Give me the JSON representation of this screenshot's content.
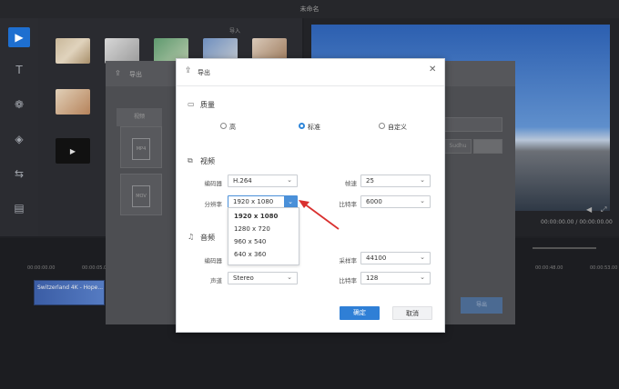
{
  "app": {
    "title": "未命名"
  },
  "editor": {
    "media_tab_label": "导入",
    "media_captions": [
      "",
      "",
      "",
      "",
      "",
      "",
      "",
      ""
    ],
    "time_display": "00:00:00.00 / 00:00:00.00",
    "ruler_labels": [
      "00:00:00.00",
      "00:00:05.00",
      "00:00:48.00",
      "00:00:53.00"
    ],
    "clip_label": "Switzerland 4K - Hope..."
  },
  "bg_dialog": {
    "title": "导出",
    "tab": "视频",
    "format1": "MP4",
    "format2": "MOV",
    "right_button": "导出",
    "mid_label": "Sudhu"
  },
  "dialog": {
    "title": "导出",
    "close_icon": "close-icon",
    "quality": {
      "title": "质量",
      "options": [
        {
          "label": "高",
          "checked": false
        },
        {
          "label": "标准",
          "checked": true
        },
        {
          "label": "自定义",
          "checked": false
        }
      ]
    },
    "video": {
      "title": "视频",
      "encoder_label": "编码器",
      "encoder_value": "H.264",
      "framerate_label": "帧速",
      "framerate_value": "25",
      "resolution_label": "分辨率",
      "resolution_value": "1920 x 1080",
      "bitrate_label": "比特率",
      "bitrate_value": "6000",
      "resolution_options": [
        "1920 x 1080",
        "1280 x 720",
        "960 x 540",
        "640 x 360"
      ]
    },
    "audio": {
      "title": "音频",
      "encoder_label": "编码器",
      "samplerate_label": "采样率",
      "samplerate_value": "44100",
      "channel_label": "声道",
      "channel_value": "Stereo",
      "bitrate_label": "比特率",
      "bitrate_value": "128"
    },
    "ok_label": "确定",
    "cancel_label": "取消"
  },
  "colors": {
    "accent": "#2f7fd6",
    "arrow": "#d9302f"
  }
}
